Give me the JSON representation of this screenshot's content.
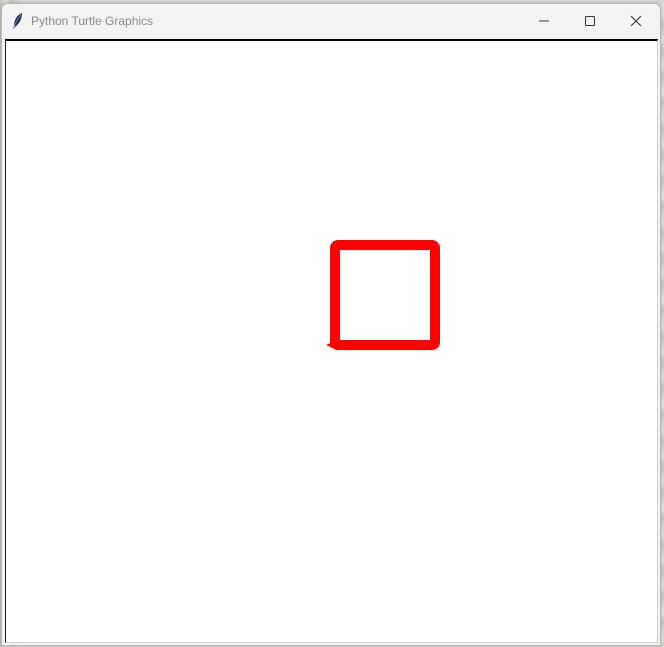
{
  "window": {
    "title": "Python Turtle Graphics",
    "app_icon": "feather-icon"
  },
  "controls": {
    "minimize": "minimize-icon",
    "maximize": "maximize-icon",
    "close": "close-icon"
  },
  "drawing": {
    "shape": "square",
    "pen_color": "#ff0000",
    "turtle_color": "#ff0000",
    "background": "#ffffff"
  }
}
